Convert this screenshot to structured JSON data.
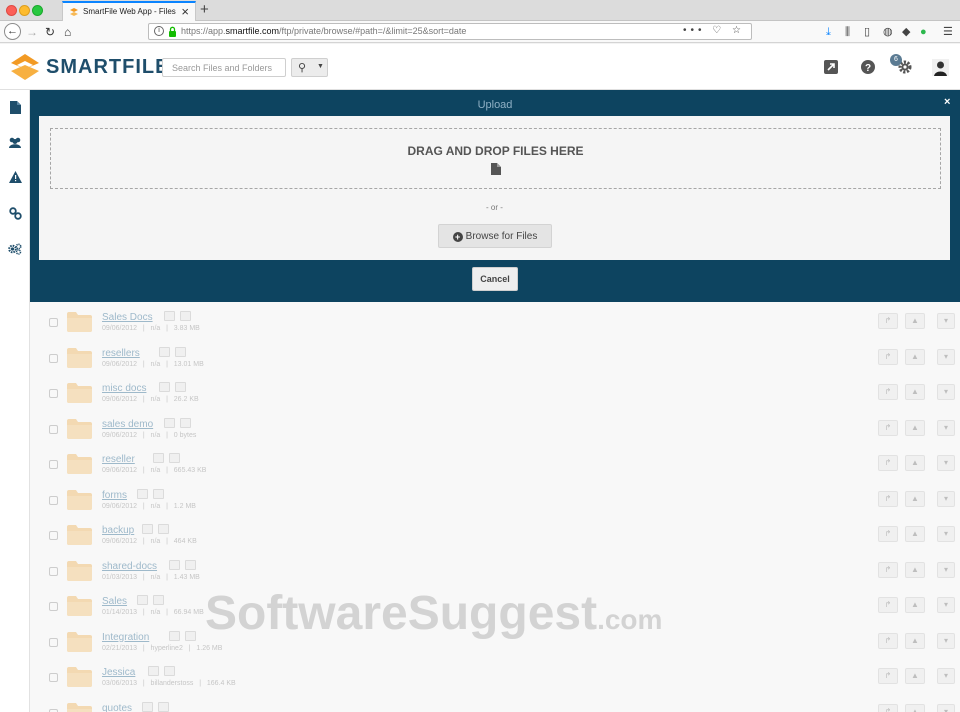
{
  "browser": {
    "tab_title": "SmartFile Web App - Files",
    "url_prefix": "https://app.",
    "url_domain": "smartfile.com",
    "url_path": "/ftp/private/browse/#path=/&limit=25&sort=date",
    "url_icons": "••• ♡ ☆"
  },
  "app": {
    "logo": "SMARTFILE",
    "search_placeholder": "Search Files and Folders",
    "notification_count": "6",
    "brand_navy": "#0d4460",
    "brand_orange": "#f29a24"
  },
  "modal": {
    "title": "Upload",
    "close": "×",
    "drop_text": "DRAG AND DROP FILES HERE",
    "or_text": "- or -",
    "browse_label": "Browse for Files",
    "cancel_label": "Cancel"
  },
  "files": [
    {
      "name": "Sales Docs",
      "date": "09/06/2012",
      "owner": "n/a",
      "size": "3.83 MB"
    },
    {
      "name": "resellers",
      "date": "09/06/2012",
      "owner": "n/a",
      "size": "13.01 MB"
    },
    {
      "name": "misc docs",
      "date": "09/06/2012",
      "owner": "n/a",
      "size": "26.2 KB"
    },
    {
      "name": "sales demo",
      "date": "09/06/2012",
      "owner": "n/a",
      "size": "0 bytes"
    },
    {
      "name": "reseller",
      "date": "09/06/2012",
      "owner": "n/a",
      "size": "665.43 KB"
    },
    {
      "name": "forms",
      "date": "09/06/2012",
      "owner": "n/a",
      "size": "1.2 MB"
    },
    {
      "name": "backup",
      "date": "09/06/2012",
      "owner": "n/a",
      "size": "464 KB"
    },
    {
      "name": "shared-docs",
      "date": "01/03/2013",
      "owner": "n/a",
      "size": "1.43 MB"
    },
    {
      "name": "Sales",
      "date": "01/14/2013",
      "owner": "n/a",
      "size": "66.94 MB"
    },
    {
      "name": "Integration",
      "date": "02/21/2013",
      "owner": "hyperline2",
      "size": "1.26 MB"
    },
    {
      "name": "Jessica",
      "date": "03/06/2013",
      "owner": "billanderstoss",
      "size": "166.4 KB"
    },
    {
      "name": "quotes",
      "date": "",
      "owner": "",
      "size": ""
    }
  ],
  "watermark": {
    "main": "SoftwareSuggest",
    "tld": ".com"
  }
}
